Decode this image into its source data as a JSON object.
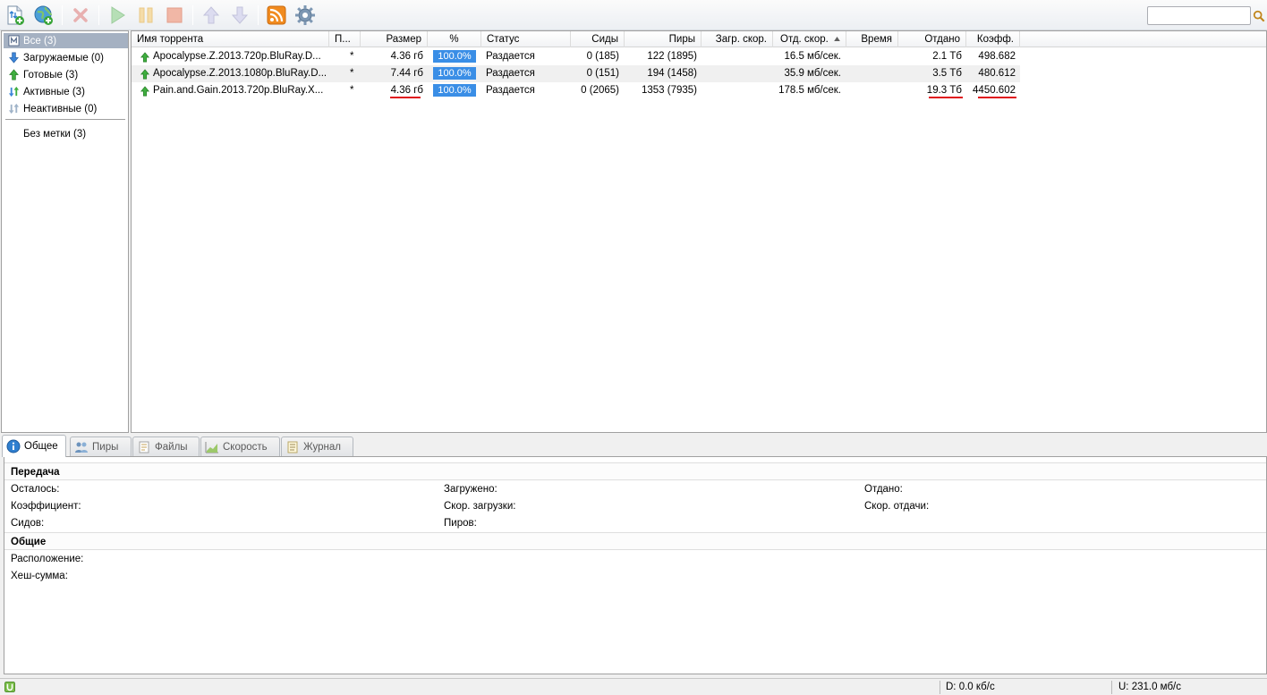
{
  "toolbar": {
    "buttons": [
      {
        "name": "add-torrent",
        "icon": "add-torrent-icon"
      },
      {
        "name": "add-url",
        "icon": "add-url-icon"
      },
      {
        "name": "remove",
        "icon": "remove-icon"
      },
      {
        "name": "start",
        "icon": "play-icon"
      },
      {
        "name": "pause",
        "icon": "pause-icon"
      },
      {
        "name": "stop",
        "icon": "stop-icon"
      },
      {
        "name": "move-up",
        "icon": "arrow-up-icon"
      },
      {
        "name": "move-down",
        "icon": "arrow-down-icon"
      },
      {
        "name": "rss",
        "icon": "rss-icon"
      },
      {
        "name": "settings",
        "icon": "gear-icon"
      }
    ],
    "search_placeholder": ""
  },
  "sidebar": {
    "items": [
      {
        "label": "Все (3)",
        "icon": "all-icon",
        "selected": true
      },
      {
        "label": "Загружаемые (0)",
        "icon": "download-arrow-icon"
      },
      {
        "label": "Готовые (3)",
        "icon": "upload-arrow-icon"
      },
      {
        "label": "Активные (3)",
        "icon": "active-arrows-icon"
      },
      {
        "label": "Неактивные (0)",
        "icon": "inactive-arrows-icon"
      }
    ],
    "labels": [
      {
        "label": "Без метки (3)"
      }
    ]
  },
  "table": {
    "columns": [
      "Имя торрента",
      "П...",
      "Размер",
      "%",
      "Статус",
      "Сиды",
      "Пиры",
      "Загр. скор.",
      "Отд. скор.",
      "Время",
      "Отдано",
      "Коэфф."
    ],
    "rows": [
      {
        "name": "Apocalypse.Z.2013.720p.BluRay.D...",
        "priority": "*",
        "size": "4.36 гб",
        "percent": "100.0%",
        "status": "Раздается",
        "seeds": "0 (185)",
        "peers": "122 (1895)",
        "down_speed": "",
        "up_speed": "16.5 мб/сек.",
        "eta": "",
        "uploaded": "2.1 Тб",
        "ratio": "498.682"
      },
      {
        "name": "Apocalypse.Z.2013.1080p.BluRay.D...",
        "priority": "*",
        "size": "7.44 гб",
        "percent": "100.0%",
        "status": "Раздается",
        "seeds": "0 (151)",
        "peers": "194 (1458)",
        "down_speed": "",
        "up_speed": "35.9 мб/сек.",
        "eta": "",
        "uploaded": "3.5 Тб",
        "ratio": "480.612"
      },
      {
        "name": "Pain.and.Gain.2013.720p.BluRay.X...",
        "priority": "*",
        "size": "4.36 гб",
        "percent": "100.0%",
        "status": "Раздается",
        "seeds": "0 (2065)",
        "peers": "1353 (7935)",
        "down_speed": "",
        "up_speed": "178.5 мб/сек.",
        "eta": "",
        "uploaded": "19.3 Тб",
        "ratio": "4450.602"
      }
    ],
    "sort_column": "Отд. скор.",
    "highlight_color": "#e0121c"
  },
  "tabs": [
    {
      "label": "Общее",
      "icon": "info-icon",
      "active": true
    },
    {
      "label": "Пиры",
      "icon": "peers-icon"
    },
    {
      "label": "Файлы",
      "icon": "files-icon"
    },
    {
      "label": "Скорость",
      "icon": "speed-chart-icon"
    },
    {
      "label": "Журнал",
      "icon": "log-icon"
    }
  ],
  "details": {
    "transfer_title": "Передача",
    "transfer_fields": {
      "remaining": "Осталось:",
      "downloaded": "Загружено:",
      "uploaded": "Отдано:",
      "ratio": "Коэффициент:",
      "down_speed": "Скор. загрузки:",
      "up_speed": "Скор. отдачи:",
      "seeds": "Сидов:",
      "peers": "Пиров:"
    },
    "general_title": "Общие",
    "general_fields": {
      "location": "Расположение:",
      "hash": "Хеш-сумма:"
    }
  },
  "statusbar": {
    "down": "D: 0.0 кб/с",
    "up": "U: 231.0 мб/с",
    "icon": "utorrent-icon"
  }
}
